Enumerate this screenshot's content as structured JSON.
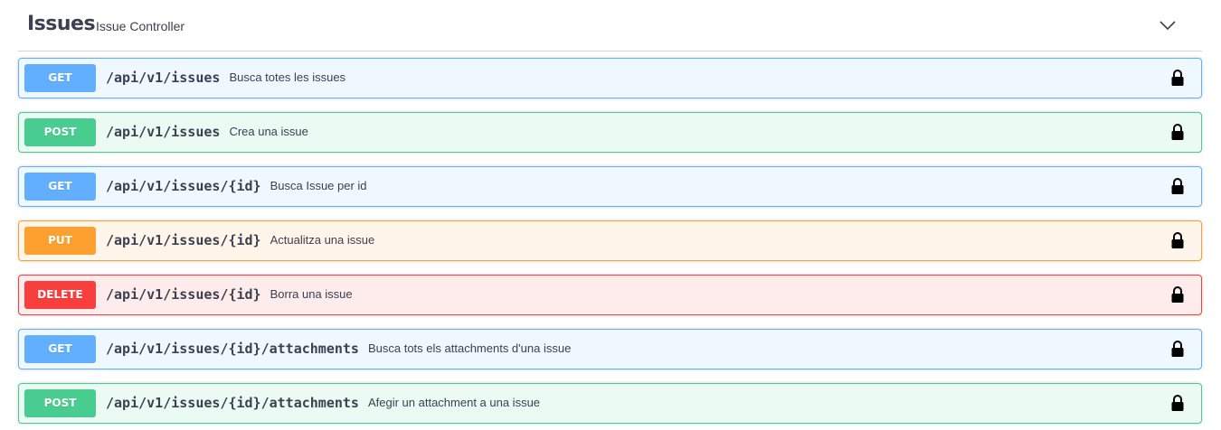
{
  "tag": {
    "title": "Issues",
    "description": "Issue Controller",
    "toggle_icon": "chevron-down-icon"
  },
  "operations": [
    {
      "method": "GET",
      "path": "/api/v1/issues",
      "summary": "Busca totes les issues",
      "locked": true
    },
    {
      "method": "POST",
      "path": "/api/v1/issues",
      "summary": "Crea una issue",
      "locked": true
    },
    {
      "method": "GET",
      "path": "/api/v1/issues/{id}",
      "summary": "Busca Issue per id",
      "locked": true
    },
    {
      "method": "PUT",
      "path": "/api/v1/issues/{id}",
      "summary": "Actualitza una issue",
      "locked": true
    },
    {
      "method": "DELETE",
      "path": "/api/v1/issues/{id}",
      "summary": "Borra una issue",
      "locked": true
    },
    {
      "method": "GET",
      "path": "/api/v1/issues/{id}/attachments",
      "summary": "Busca tots els attachments d'una issue",
      "locked": true
    },
    {
      "method": "POST",
      "path": "/api/v1/issues/{id}/attachments",
      "summary": "Afegir un attachment a una issue",
      "locked": true
    }
  ],
  "colors": {
    "GET": "#61affe",
    "POST": "#49cc90",
    "PUT": "#fca130",
    "DELETE": "#f93e3e"
  }
}
